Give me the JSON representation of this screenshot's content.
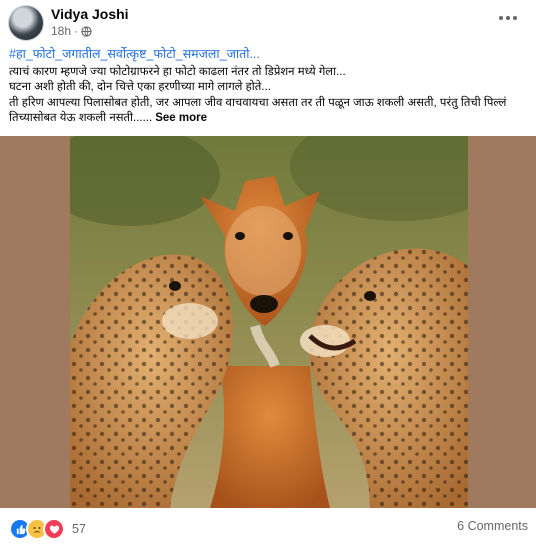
{
  "post": {
    "author": "Vidya Joshi",
    "time": "18h",
    "privacy_icon": "globe-icon",
    "hashtag": "#हा_फोटो_जगातील_सर्वोत्कृष्ट_फोटो_समजला_जातो...",
    "lines": [
      "त्याचं कारण म्हणजे ज्या फोटोग्राफरने हा फोटो काढला नंतर तो डिप्रेशन मध्ये गेला...",
      "घटना अशी होती की, दोन चित्ते एका हरणीच्या मागे लागले होते...",
      "ती हरिण आपल्या पिलासोबत होती, जर आपला जीव वाचवायचा असता तर ती पळून जाऊ शकली असती, परंतु तिची पिल्लं",
      "तिच्यासोबत येऊ शकली नसती......"
    ],
    "see_more": "See more",
    "more_icon": "more-horizontal-icon"
  },
  "photo": {
    "subject": "cheetahs-and-antelope-photo",
    "background_color": "#9f7a5e"
  },
  "footer": {
    "reaction_icons": [
      "like-icon",
      "sad-icon",
      "love-icon"
    ],
    "reaction_count": "57",
    "comments": "6 Comments"
  }
}
